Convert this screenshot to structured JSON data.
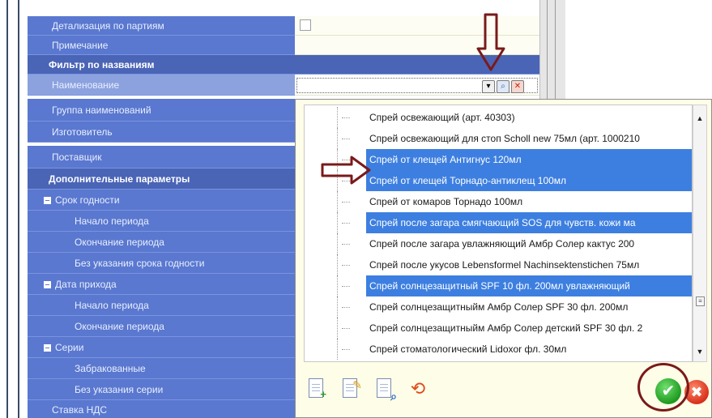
{
  "rows": [
    {
      "label": "Детализация по партиям",
      "kind": "field",
      "control": "checkbox"
    },
    {
      "label": "Примечание",
      "kind": "field"
    },
    {
      "label": "Фильтр по названиям",
      "kind": "header"
    },
    {
      "label": "Наименование",
      "kind": "field",
      "control": "combo",
      "selected": true
    },
    {
      "label": "Группа наименований",
      "kind": "field"
    },
    {
      "label": "Изготовитель",
      "kind": "field"
    },
    {
      "label": "Поставщик",
      "kind": "field"
    },
    {
      "label": "Дополнительные параметры",
      "kind": "header"
    },
    {
      "label": "Срок годности",
      "kind": "group"
    },
    {
      "label": "Начало периода",
      "kind": "sub"
    },
    {
      "label": "Окончание периода",
      "kind": "sub"
    },
    {
      "label": "Без указания срока годности",
      "kind": "sub"
    },
    {
      "label": "Дата прихода",
      "kind": "group"
    },
    {
      "label": "Начало периода",
      "kind": "sub"
    },
    {
      "label": "Окончание периода",
      "kind": "sub"
    },
    {
      "label": "Серии",
      "kind": "group"
    },
    {
      "label": "Забракованные",
      "kind": "sub"
    },
    {
      "label": "Без указания серии",
      "kind": "sub"
    },
    {
      "label": "Ставка НДС",
      "kind": "field"
    }
  ],
  "combo": {
    "icons": [
      "chevron-down-icon",
      "search-icon",
      "close-icon"
    ]
  },
  "list_items": [
    {
      "text": "Спрей освежающий (арт. 40303)",
      "selected": false
    },
    {
      "text": "Спрей освежающий для стоп Scholl new 75мл (арт. 1000210",
      "selected": false
    },
    {
      "text": "Спрей от клещей Антигнус 120мл",
      "selected": true
    },
    {
      "text": "Спрей от клещей Торнадо-антиклещ 100мл",
      "selected": true
    },
    {
      "text": "Спрей от комаров Торнадо 100мл",
      "selected": false
    },
    {
      "text": "Спрей после загара смягчающий SOS для чувств. кожи ма",
      "selected": true
    },
    {
      "text": "Спрей после загара увлажняющий Амбр Солер кактус 200",
      "selected": false
    },
    {
      "text": "Спрей после укусов Lebensformel Nachinsektenstichen 75мл",
      "selected": false
    },
    {
      "text": "Спрей солнцезащитный SPF 10 фл. 200мл увлажняющий",
      "selected": true
    },
    {
      "text": "Спрей солнцезащитныйм Амбр Солер SPF 30 фл. 200мл",
      "selected": false
    },
    {
      "text": "Спрей солнцезащитныйм Амбр Солер детский SPF 30 фл. 2",
      "selected": false
    },
    {
      "text": "Спрей стоматологический Lidoxor фл. 30мл",
      "selected": false
    }
  ],
  "toolbar": {
    "icons": [
      "add-document-icon",
      "edit-document-icon",
      "view-document-icon",
      "refresh-icon"
    ],
    "ok_icon": "checkmark-icon",
    "cancel_icon": "cancel-icon"
  },
  "annotations": {
    "color": "#7a1a1a",
    "items": [
      "arrow-down-annotation",
      "arrow-right-annotation",
      "circle-annotation"
    ]
  },
  "colors": {
    "label_bg": "#5a78cf",
    "header_bg": "#4a64b6",
    "selection": "#3d7fe0",
    "value_bg": "#fdfdf3"
  }
}
